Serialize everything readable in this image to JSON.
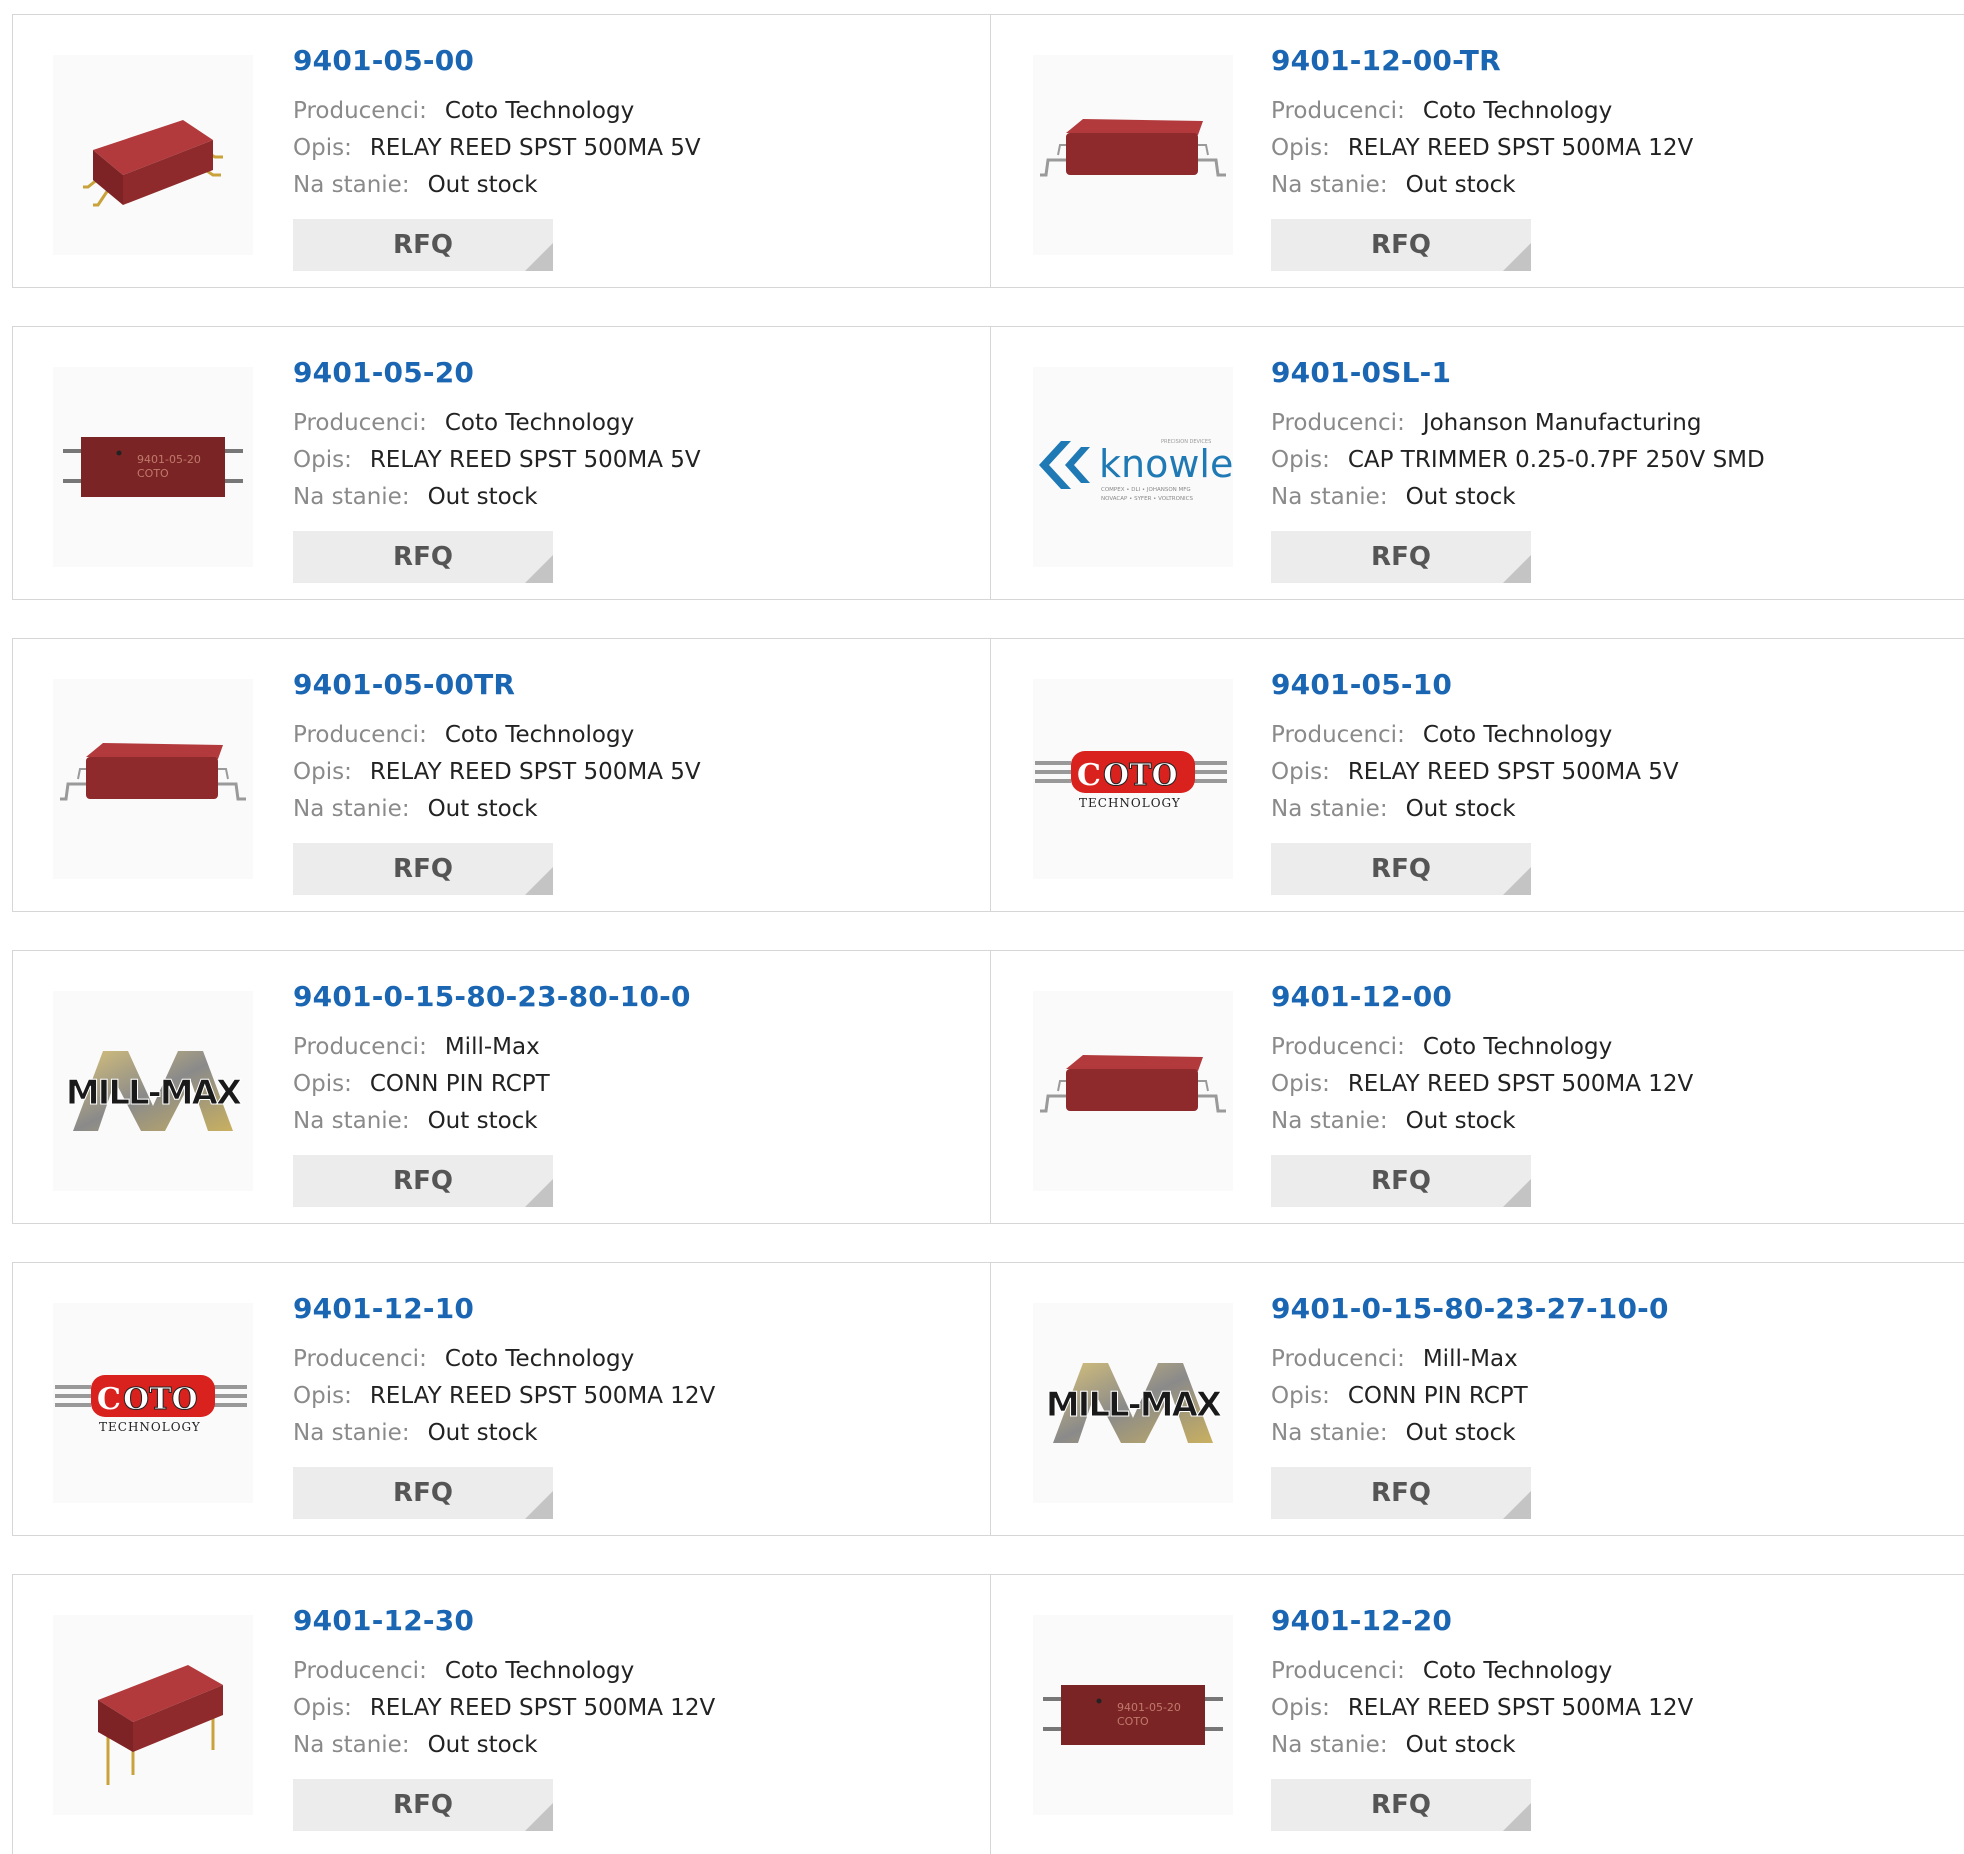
{
  "labels": {
    "manufacturer": "Producenci:",
    "description": "Opis:",
    "stock": "Na stanie:",
    "rfq": "RFQ"
  },
  "products": [
    {
      "part": "9401-05-00",
      "manufacturer": "Coto Technology",
      "description": "RELAY REED SPST 500MA 5V",
      "stock": "Out stock",
      "image": "relay-dip-icon"
    },
    {
      "part": "9401-12-00-TR",
      "manufacturer": "Coto Technology",
      "description": "RELAY REED SPST 500MA 12V",
      "stock": "Out stock",
      "image": "relay-smd-icon"
    },
    {
      "part": "9401-05-20",
      "manufacturer": "Coto Technology",
      "description": "RELAY REED SPST 500MA 5V",
      "stock": "Out stock",
      "image": "relay-flat-icon"
    },
    {
      "part": "9401-0SL-1",
      "manufacturer": "Johanson Manufacturing",
      "description": "CAP TRIMMER 0.25-0.7PF 250V SMD",
      "stock": "Out stock",
      "image": "knowles-logo"
    },
    {
      "part": "9401-05-00TR",
      "manufacturer": "Coto Technology",
      "description": "RELAY REED SPST 500MA 5V",
      "stock": "Out stock",
      "image": "relay-smd-icon"
    },
    {
      "part": "9401-05-10",
      "manufacturer": "Coto Technology",
      "description": "RELAY REED SPST 500MA 5V",
      "stock": "Out stock",
      "image": "coto-logo"
    },
    {
      "part": "9401-0-15-80-23-80-10-0",
      "manufacturer": "Mill-Max",
      "description": "CONN PIN RCPT",
      "stock": "Out stock",
      "image": "millmax-logo"
    },
    {
      "part": "9401-12-00",
      "manufacturer": "Coto Technology",
      "description": "RELAY REED SPST 500MA 12V",
      "stock": "Out stock",
      "image": "relay-smd-icon"
    },
    {
      "part": "9401-12-10",
      "manufacturer": "Coto Technology",
      "description": "RELAY REED SPST 500MA 12V",
      "stock": "Out stock",
      "image": "coto-logo"
    },
    {
      "part": "9401-0-15-80-23-27-10-0",
      "manufacturer": "Mill-Max",
      "description": "CONN PIN RCPT",
      "stock": "Out stock",
      "image": "millmax-logo"
    },
    {
      "part": "9401-12-30",
      "manufacturer": "Coto Technology",
      "description": "RELAY REED SPST 500MA 12V",
      "stock": "Out stock",
      "image": "relay-thru-icon"
    },
    {
      "part": "9401-12-20",
      "manufacturer": "Coto Technology",
      "description": "RELAY REED SPST 500MA 12V",
      "stock": "Out stock",
      "image": "relay-flat-icon"
    }
  ],
  "logos": {
    "knowles": {
      "text": "knowles",
      "top": "PRECISION DEVICES",
      "bottom1": "COMPEX • DLI • JOHANSON MFG",
      "bottom2": "NOVACAP • SYFER • VOLTRONICS"
    },
    "coto": {
      "text": "OTO",
      "initial": "C",
      "sub": "TECHNOLOGY"
    },
    "millmax": {
      "text": "MILL-MAX"
    }
  },
  "colors": {
    "link": "#1a66b3",
    "relay": "#8e2a2c",
    "rfq_bg": "#ececec"
  }
}
